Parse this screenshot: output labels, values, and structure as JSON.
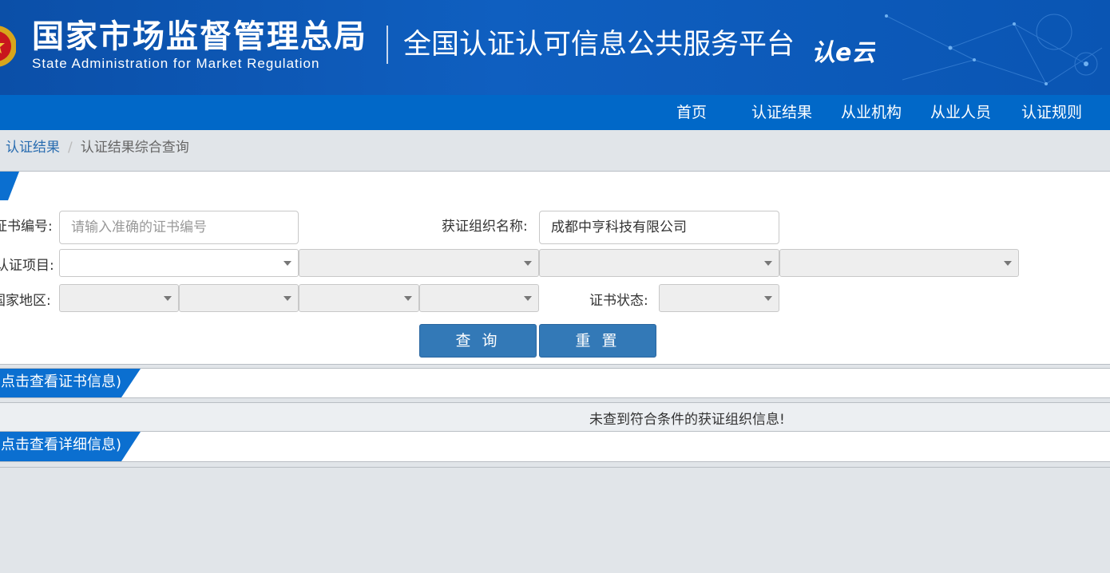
{
  "header": {
    "org_name_cn": "国家市场监督管理总局",
    "org_name_en": "State Administration  for  Market Regulation",
    "platform_title": "全国认证认可信息公共服务平台",
    "cloud_logo_text": "认e云",
    "emblem_icon": "national-emblem-icon"
  },
  "nav": {
    "items": [
      "首页",
      "认证结果",
      "从业机构",
      "从业人员",
      "认证规则"
    ]
  },
  "breadcrumb": {
    "parent": "认证结果",
    "separator": "/",
    "current": "认证结果综合查询"
  },
  "form": {
    "cert_no_label": "证书编号:",
    "cert_no_placeholder": "请输入准确的证书编号",
    "cert_no_value": "",
    "org_name_label": "获证组织名称:",
    "org_name_value": "成都中亨科技有限公司",
    "project_label": "认证项目:",
    "region_label": "国家地区:",
    "status_label": "证书状态:",
    "query_button": "查 询",
    "reset_button": "重 置"
  },
  "sections": {
    "cert_tab_label": "(点击查看证书信息)",
    "detail_tab_label": "(点击查看详细信息)"
  },
  "results": {
    "empty_message": "未查到符合条件的获证组织信息!"
  },
  "colors": {
    "header_blue": "#0f5fc0",
    "nav_blue": "#0168c8",
    "button_blue": "#3379b7",
    "tab_blue": "#0b6fd0"
  }
}
